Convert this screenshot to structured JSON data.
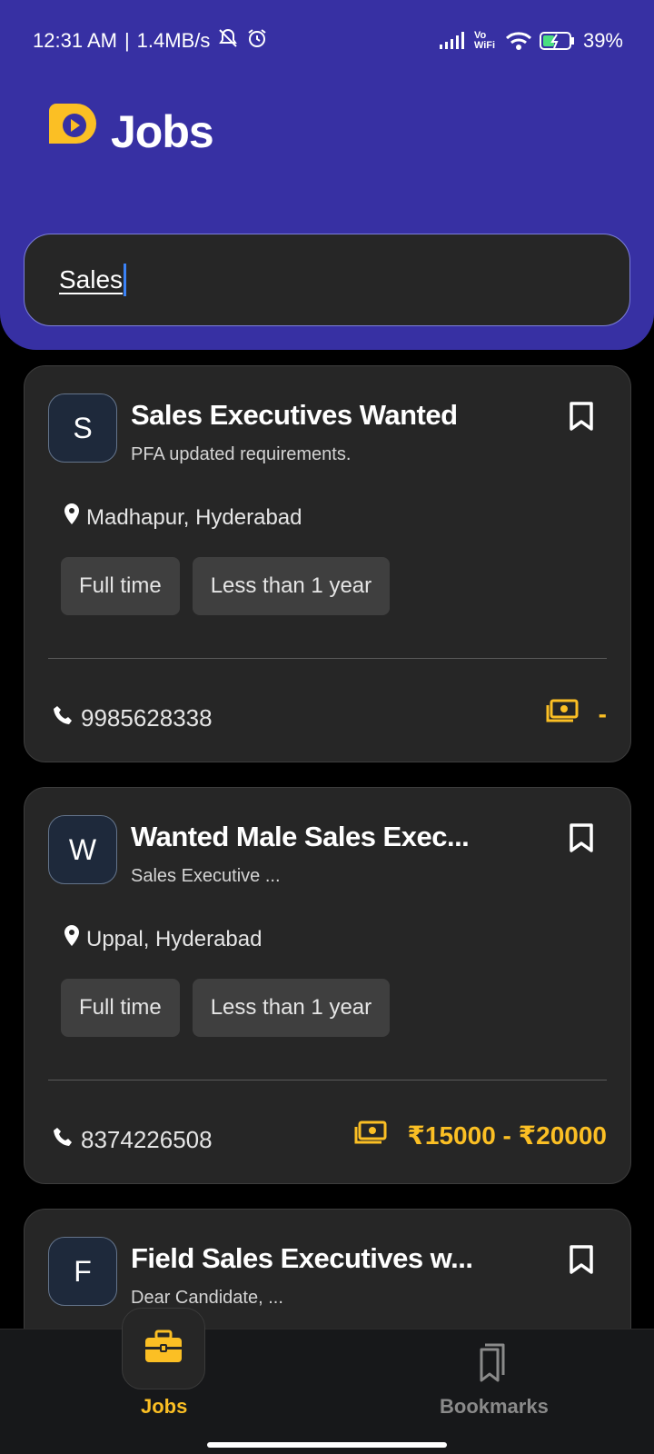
{
  "status_bar": {
    "time": "12:31 AM",
    "speed": "1.4MB/s",
    "network": "Vo WiFi",
    "battery": "39%"
  },
  "header": {
    "title": "Jobs",
    "brand_color": "#fbbf24",
    "background": "#3730a3"
  },
  "search": {
    "value": "Sales"
  },
  "jobs": [
    {
      "initial": "S",
      "title": "Sales Executives Wanted",
      "subtitle": "PFA updated requirements.",
      "location": "Madhapur, Hyderabad",
      "tags": [
        "Full time",
        "Less than 1 year"
      ],
      "phone": "9985628338",
      "salary": "-"
    },
    {
      "initial": "W",
      "title": "Wanted Male Sales Exec...",
      "subtitle": "Sales Executive ...",
      "location": "Uppal, Hyderabad",
      "tags": [
        "Full time",
        "Less than 1 year"
      ],
      "phone": "8374226508",
      "salary": "₹15000 - ₹20000"
    },
    {
      "initial": "F",
      "title": "Field Sales Executives w...",
      "subtitle": "Dear Candidate, ..."
    }
  ],
  "bottom_nav": {
    "jobs_label": "Jobs",
    "bookmarks_label": "Bookmarks",
    "active": "Jobs",
    "active_color": "#fbbf24"
  }
}
